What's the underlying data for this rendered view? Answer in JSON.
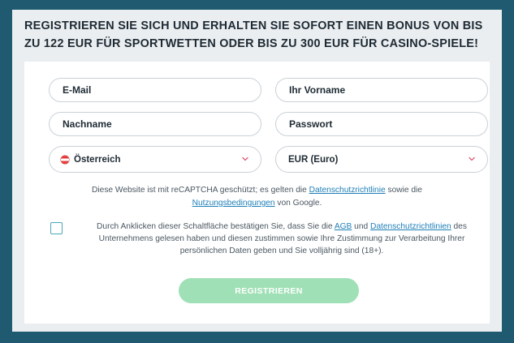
{
  "headline": "REGISTRIEREN SIE SICH UND ERHALTEN SIE SOFORT EINEN BONUS VON BIS ZU 122 EUR FÜR SPORTWETTEN ODER BIS ZU 300 EUR FÜR CASINO-SPIELE!",
  "form": {
    "email_placeholder": "E-Mail",
    "firstname_placeholder": "Ihr Vorname",
    "lastname_placeholder": "Nachname",
    "password_placeholder": "Passwort",
    "country": {
      "value": "Österreich",
      "flag_icon": "austria-flag-icon"
    },
    "currency": {
      "value": "EUR (Euro)"
    },
    "chevron_icon": "chevron-down-icon",
    "chevron_color": "#e0607a"
  },
  "recaptcha": {
    "text_1": "Diese Website ist mit reCAPTCHA geschützt; es gelten die ",
    "privacy_link": "Datenschutzrichtlinie",
    "text_2": " sowie die ",
    "terms_link": "Nutzungsbedingungen",
    "text_3": " von Google."
  },
  "consent": {
    "text_1": "Durch Anklicken dieser Schaltfläche bestätigen Sie, dass Sie die ",
    "agb_link": "AGB",
    "text_2": " und ",
    "privacy_link": "Datenschutzrichtlinien",
    "text_3": " des Unternehmens gelesen haben und diesen zustimmen sowie Ihre Zustimmung zur Verarbeitung Ihrer persönlichen Daten geben und Sie volljährig sind (18+).",
    "checked": false
  },
  "submit_label": "REGISTRIEREN",
  "colors": {
    "background": "#1f5a70",
    "panel": "#eaeef1",
    "button": "#9fe0b6",
    "link": "#1e7fb8",
    "checkbox_border": "#4aa8b4"
  }
}
